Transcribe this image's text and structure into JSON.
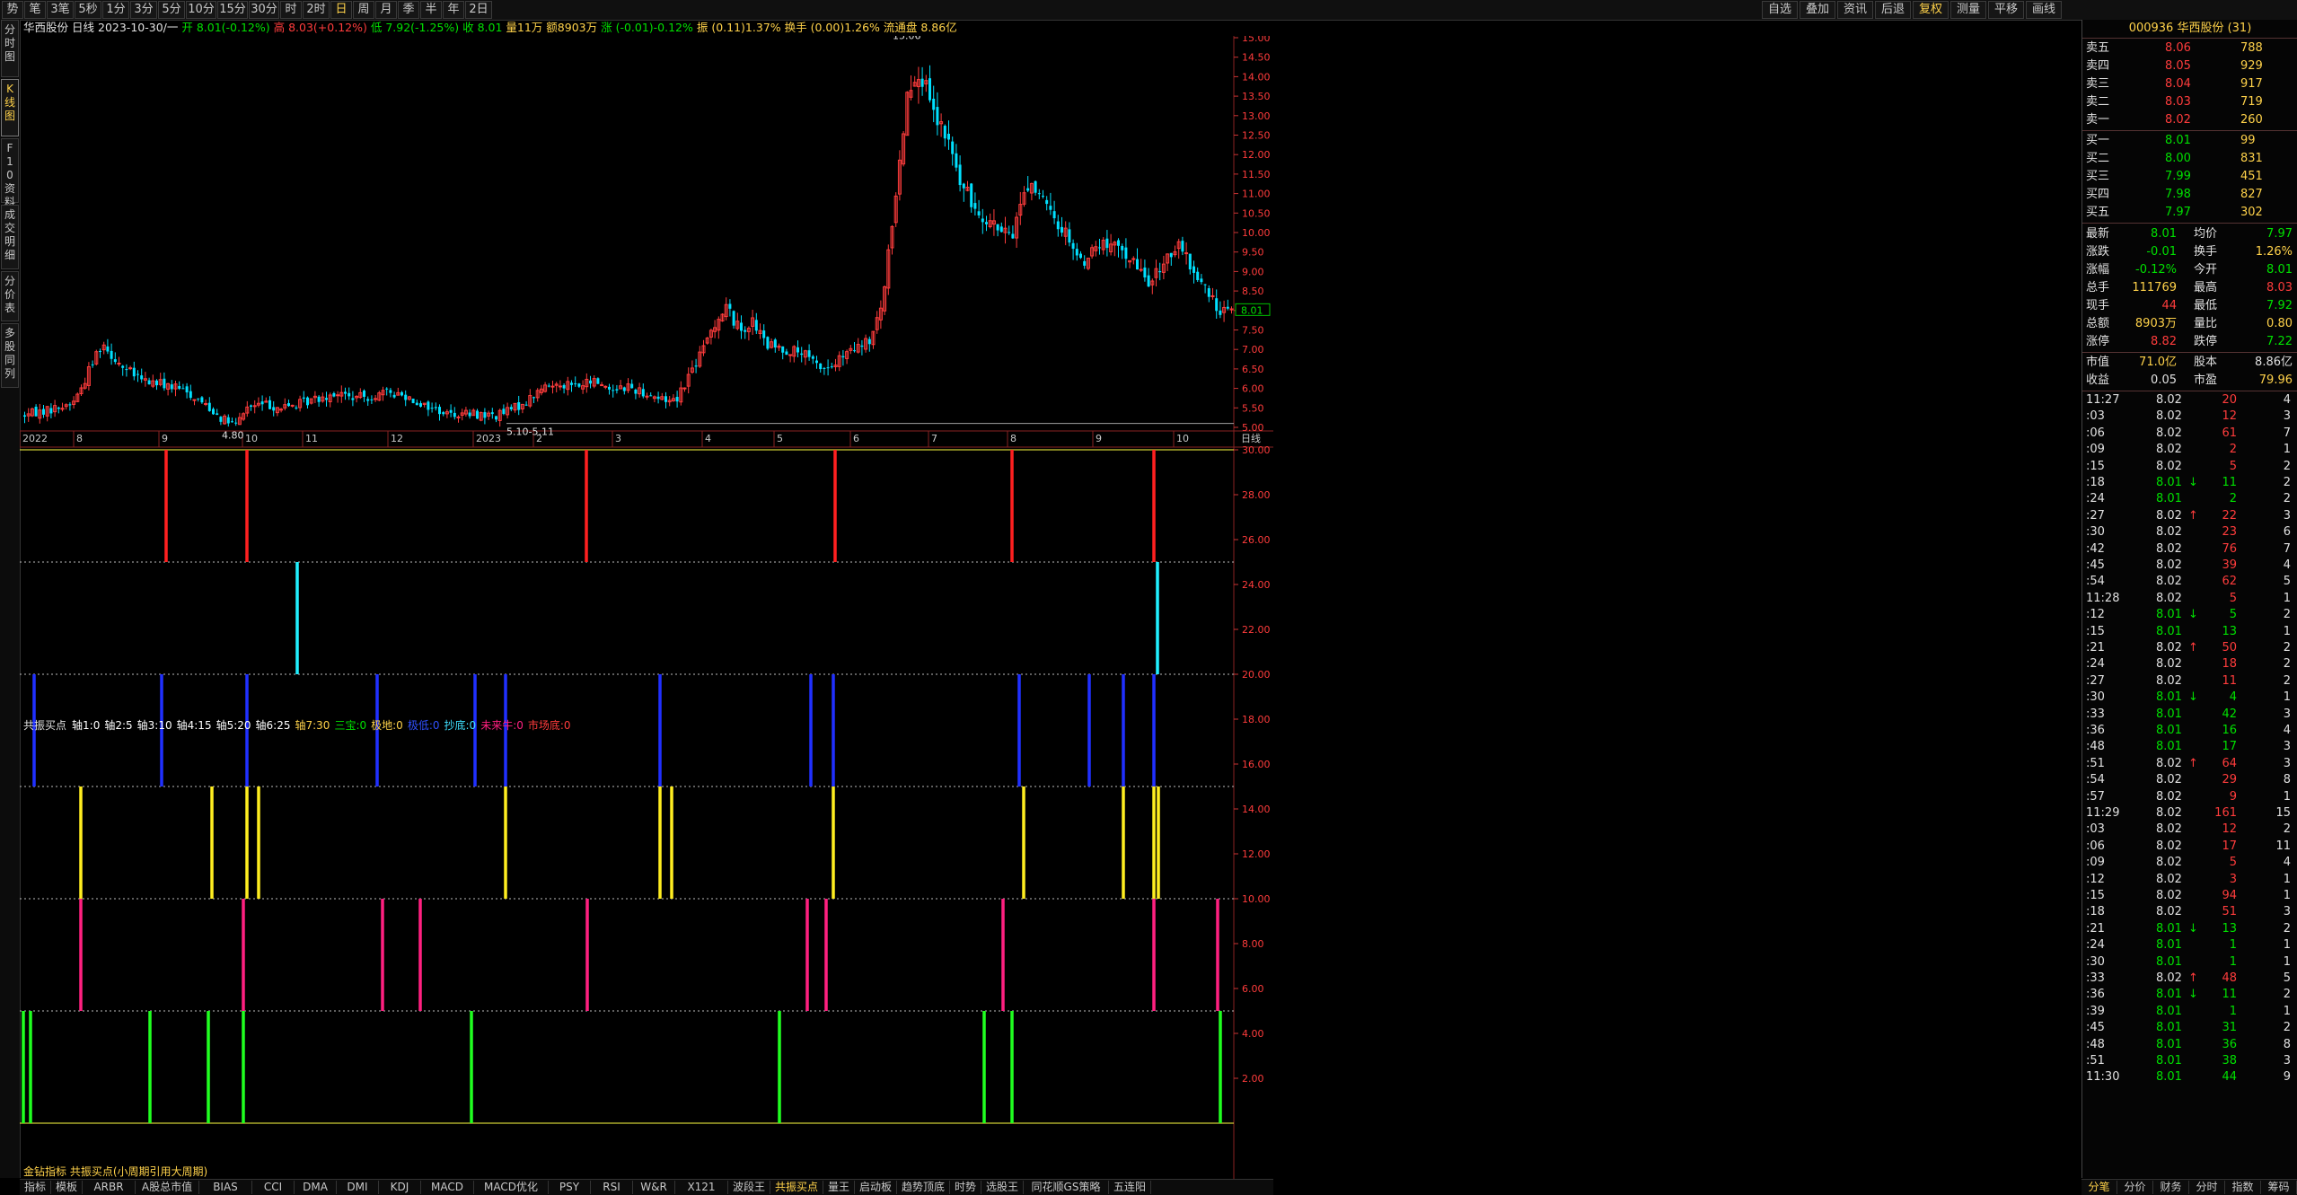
{
  "top_toolbar": {
    "left_buttons": [
      "势",
      "笔",
      "3笔",
      "5秒",
      "1分",
      "3分",
      "5分",
      "10分",
      "15分",
      "30分",
      "时",
      "2时",
      "日",
      "周",
      "月",
      "季",
      "半",
      "年",
      "2日"
    ],
    "active_button": "日",
    "right_buttons": [
      "自选",
      "叠加",
      "资讯",
      "后退",
      "复权",
      "测量",
      "平移",
      "画线"
    ],
    "right_active": "复权"
  },
  "left_nav": [
    {
      "label": "分时图",
      "active": false
    },
    {
      "label": "K线图",
      "active": true
    },
    {
      "label": "F10资料",
      "active": false
    },
    {
      "label": "成交明细",
      "active": false
    },
    {
      "label": "分价表",
      "active": false
    },
    {
      "label": "多股同列",
      "active": false
    }
  ],
  "info_bar": {
    "stock_name": "华西股份",
    "period": "日线",
    "date": "2023-10-30/一",
    "open": "开 8.01(-0.12%)",
    "high": "高 8.03(+0.12%)",
    "low": "低 7.92(-1.25%)",
    "close": "收 8.01",
    "volume": "量11万",
    "amount": "额8903万",
    "change": "涨 (-0.01)-0.12%",
    "amplitude": "振 (0.11)1.37%",
    "turnover": "换手 (0.00)1.26%",
    "float_cap": "流通盘 8.86亿"
  },
  "price_axis": {
    "labels": [
      "15.00",
      "14.50",
      "14.00",
      "13.50",
      "13.00",
      "12.50",
      "12.00",
      "11.50",
      "11.00",
      "10.50",
      "10.00",
      "9.50",
      "9.00",
      "8.50",
      "8.00",
      "7.50",
      "7.00",
      "6.50",
      "6.00",
      "5.50",
      "5.00"
    ],
    "current_price_tag": "8.01"
  },
  "annotations": {
    "peak": "15.06",
    "low1": "4.80",
    "range_low": "5.10-5.11"
  },
  "time_axis": {
    "labels": [
      "2022",
      "8",
      "9",
      "10",
      "11",
      "12",
      "2023",
      "2",
      "3",
      "4",
      "5",
      "6",
      "7",
      "8",
      "9",
      "10"
    ],
    "period_label": "日线"
  },
  "indicator_bar": {
    "name": "共振买点",
    "items": [
      {
        "text": "轴1:0",
        "color": "#ffffff"
      },
      {
        "text": "轴2:5",
        "color": "#ffffff"
      },
      {
        "text": "轴3:10",
        "color": "#ffffff"
      },
      {
        "text": "轴4:15",
        "color": "#ffffff"
      },
      {
        "text": "轴5:20",
        "color": "#ffffff"
      },
      {
        "text": "轴6:25",
        "color": "#ffffff"
      },
      {
        "text": "轴7:30",
        "color": "#ffd24a"
      },
      {
        "text": "三宝:0",
        "color": "#00e000"
      },
      {
        "text": "极地:0",
        "color": "#ffd24a"
      },
      {
        "text": "极低:0",
        "color": "#3050ff"
      },
      {
        "text": "抄底:0",
        "color": "#3fe0ff"
      },
      {
        "text": "未来牛:0",
        "color": "#ff2080"
      },
      {
        "text": "市场底:0",
        "color": "#ff3c3c"
      }
    ]
  },
  "indicator_axis": {
    "labels": [
      "30.00",
      "28.00",
      "26.00",
      "24.00",
      "22.00",
      "20.00",
      "18.00",
      "16.00",
      "14.00",
      "12.00",
      "10.00",
      "8.00",
      "6.00",
      "4.00",
      "2.00"
    ]
  },
  "indicator_footer": "金钻指标 共振买点(小周期引用大周期)",
  "bottom_tabs": [
    "指标",
    "模板",
    "ARBR",
    "A股总市值",
    "BIAS",
    "CCI",
    "DMA",
    "DMI",
    "KDJ",
    "MACD",
    "MACD优化",
    "PSY",
    "RSI",
    "W&R",
    "X121",
    "波段王",
    "共振买点",
    "量王",
    "启动板",
    "趋势顶底",
    "时势",
    "选股王",
    "同花顺GS策略",
    "五连阳"
  ],
  "bottom_active": "共振买点",
  "right_panel": {
    "header": "000936 华西股份 (31)",
    "asks": [
      {
        "label": "卖五",
        "price": "8.06",
        "vol": "788"
      },
      {
        "label": "卖四",
        "price": "8.05",
        "vol": "929"
      },
      {
        "label": "卖三",
        "price": "8.04",
        "vol": "917"
      },
      {
        "label": "卖二",
        "price": "8.03",
        "vol": "719"
      },
      {
        "label": "卖一",
        "price": "8.02",
        "vol": "260"
      }
    ],
    "bids": [
      {
        "label": "买一",
        "price": "8.01",
        "vol": "99"
      },
      {
        "label": "买二",
        "price": "8.00",
        "vol": "831"
      },
      {
        "label": "买三",
        "price": "7.99",
        "vol": "451"
      },
      {
        "label": "买四",
        "price": "7.98",
        "vol": "827"
      },
      {
        "label": "买五",
        "price": "7.97",
        "vol": "302"
      }
    ],
    "stats": [
      {
        "l1": "最新",
        "v1": "8.01",
        "c1": "grn",
        "l2": "均价",
        "v2": "7.97",
        "c2": "grn"
      },
      {
        "l1": "涨跌",
        "v1": "-0.01",
        "c1": "grn",
        "l2": "换手",
        "v2": "1.26%",
        "c2": "yel"
      },
      {
        "l1": "涨幅",
        "v1": "-0.12%",
        "c1": "grn",
        "l2": "今开",
        "v2": "8.01",
        "c2": "grn"
      },
      {
        "l1": "总手",
        "v1": "111769",
        "c1": "yel",
        "l2": "最高",
        "v2": "8.03",
        "c2": "red"
      },
      {
        "l1": "现手",
        "v1": "44",
        "c1": "red",
        "l2": "最低",
        "v2": "7.92",
        "c2": "grn"
      },
      {
        "l1": "总额",
        "v1": "8903万",
        "c1": "yel",
        "l2": "量比",
        "v2": "0.80",
        "c2": "yel"
      },
      {
        "l1": "涨停",
        "v1": "8.82",
        "c1": "red",
        "l2": "跌停",
        "v2": "7.22",
        "c2": "grn"
      }
    ],
    "stats2": [
      {
        "l1": "市值",
        "v1": "71.0亿",
        "c1": "yel",
        "l2": "股本",
        "v2": "8.86亿",
        "c2": "wht"
      },
      {
        "l1": "收益",
        "v1": "0.05",
        "c1": "wht",
        "l2": "市盈",
        "v2": "79.96",
        "c2": "yel"
      }
    ],
    "ticks": [
      {
        "t": "11:27",
        "p": "8.02",
        "pc": "wht",
        "a": "",
        "v": "20",
        "vc": "red",
        "n": "4"
      },
      {
        "t": ":03",
        "p": "8.02",
        "pc": "wht",
        "a": "",
        "v": "12",
        "vc": "red",
        "n": "3"
      },
      {
        "t": ":06",
        "p": "8.02",
        "pc": "wht",
        "a": "",
        "v": "61",
        "vc": "red",
        "n": "7"
      },
      {
        "t": ":09",
        "p": "8.02",
        "pc": "wht",
        "a": "",
        "v": "2",
        "vc": "red",
        "n": "1"
      },
      {
        "t": ":15",
        "p": "8.02",
        "pc": "wht",
        "a": "",
        "v": "5",
        "vc": "red",
        "n": "2"
      },
      {
        "t": ":18",
        "p": "8.01",
        "pc": "grn",
        "a": "↓",
        "v": "11",
        "vc": "grn",
        "n": "2"
      },
      {
        "t": ":24",
        "p": "8.01",
        "pc": "grn",
        "a": "",
        "v": "2",
        "vc": "grn",
        "n": "2"
      },
      {
        "t": ":27",
        "p": "8.02",
        "pc": "wht",
        "a": "↑",
        "v": "22",
        "vc": "red",
        "n": "3"
      },
      {
        "t": ":30",
        "p": "8.02",
        "pc": "wht",
        "a": "",
        "v": "23",
        "vc": "red",
        "n": "6"
      },
      {
        "t": ":42",
        "p": "8.02",
        "pc": "wht",
        "a": "",
        "v": "76",
        "vc": "red",
        "n": "7"
      },
      {
        "t": ":45",
        "p": "8.02",
        "pc": "wht",
        "a": "",
        "v": "39",
        "vc": "red",
        "n": "4"
      },
      {
        "t": ":54",
        "p": "8.02",
        "pc": "wht",
        "a": "",
        "v": "62",
        "vc": "red",
        "n": "5"
      },
      {
        "t": "11:28",
        "p": "8.02",
        "pc": "wht",
        "a": "",
        "v": "5",
        "vc": "red",
        "n": "1"
      },
      {
        "t": ":12",
        "p": "8.01",
        "pc": "grn",
        "a": "↓",
        "v": "5",
        "vc": "grn",
        "n": "2"
      },
      {
        "t": ":15",
        "p": "8.01",
        "pc": "grn",
        "a": "",
        "v": "13",
        "vc": "grn",
        "n": "1"
      },
      {
        "t": ":21",
        "p": "8.02",
        "pc": "wht",
        "a": "↑",
        "v": "50",
        "vc": "red",
        "n": "2"
      },
      {
        "t": ":24",
        "p": "8.02",
        "pc": "wht",
        "a": "",
        "v": "18",
        "vc": "red",
        "n": "2"
      },
      {
        "t": ":27",
        "p": "8.02",
        "pc": "wht",
        "a": "",
        "v": "11",
        "vc": "red",
        "n": "2"
      },
      {
        "t": ":30",
        "p": "8.01",
        "pc": "grn",
        "a": "↓",
        "v": "4",
        "vc": "grn",
        "n": "1"
      },
      {
        "t": ":33",
        "p": "8.01",
        "pc": "grn",
        "a": "",
        "v": "42",
        "vc": "grn",
        "n": "3"
      },
      {
        "t": ":36",
        "p": "8.01",
        "pc": "grn",
        "a": "",
        "v": "16",
        "vc": "grn",
        "n": "4"
      },
      {
        "t": ":48",
        "p": "8.01",
        "pc": "grn",
        "a": "",
        "v": "17",
        "vc": "grn",
        "n": "3"
      },
      {
        "t": ":51",
        "p": "8.02",
        "pc": "wht",
        "a": "↑",
        "v": "64",
        "vc": "red",
        "n": "3"
      },
      {
        "t": ":54",
        "p": "8.02",
        "pc": "wht",
        "a": "",
        "v": "29",
        "vc": "red",
        "n": "8"
      },
      {
        "t": ":57",
        "p": "8.02",
        "pc": "wht",
        "a": "",
        "v": "9",
        "vc": "red",
        "n": "1"
      },
      {
        "t": "11:29",
        "p": "8.02",
        "pc": "wht",
        "a": "",
        "v": "161",
        "vc": "red",
        "n": "15"
      },
      {
        "t": ":03",
        "p": "8.02",
        "pc": "wht",
        "a": "",
        "v": "12",
        "vc": "red",
        "n": "2"
      },
      {
        "t": ":06",
        "p": "8.02",
        "pc": "wht",
        "a": "",
        "v": "17",
        "vc": "red",
        "n": "11"
      },
      {
        "t": ":09",
        "p": "8.02",
        "pc": "wht",
        "a": "",
        "v": "5",
        "vc": "red",
        "n": "4"
      },
      {
        "t": ":12",
        "p": "8.02",
        "pc": "wht",
        "a": "",
        "v": "3",
        "vc": "red",
        "n": "1"
      },
      {
        "t": ":15",
        "p": "8.02",
        "pc": "wht",
        "a": "",
        "v": "94",
        "vc": "red",
        "n": "1"
      },
      {
        "t": ":18",
        "p": "8.02",
        "pc": "wht",
        "a": "",
        "v": "51",
        "vc": "red",
        "n": "3"
      },
      {
        "t": ":21",
        "p": "8.01",
        "pc": "grn",
        "a": "↓",
        "v": "13",
        "vc": "grn",
        "n": "2"
      },
      {
        "t": ":24",
        "p": "8.01",
        "pc": "grn",
        "a": "",
        "v": "1",
        "vc": "grn",
        "n": "1"
      },
      {
        "t": ":30",
        "p": "8.01",
        "pc": "grn",
        "a": "",
        "v": "1",
        "vc": "grn",
        "n": "1"
      },
      {
        "t": ":33",
        "p": "8.02",
        "pc": "wht",
        "a": "↑",
        "v": "48",
        "vc": "red",
        "n": "5"
      },
      {
        "t": ":36",
        "p": "8.01",
        "pc": "grn",
        "a": "↓",
        "v": "11",
        "vc": "grn",
        "n": "2"
      },
      {
        "t": ":39",
        "p": "8.01",
        "pc": "grn",
        "a": "",
        "v": "1",
        "vc": "grn",
        "n": "1"
      },
      {
        "t": ":45",
        "p": "8.01",
        "pc": "grn",
        "a": "",
        "v": "31",
        "vc": "grn",
        "n": "2"
      },
      {
        "t": ":48",
        "p": "8.01",
        "pc": "grn",
        "a": "",
        "v": "36",
        "vc": "grn",
        "n": "8"
      },
      {
        "t": ":51",
        "p": "8.01",
        "pc": "grn",
        "a": "",
        "v": "38",
        "vc": "grn",
        "n": "3"
      },
      {
        "t": "11:30",
        "p": "8.01",
        "pc": "grn",
        "a": "",
        "v": "44",
        "vc": "grn",
        "n": "9"
      }
    ],
    "bottom_tabs": [
      "分笔",
      "分价",
      "财务",
      "分时",
      "指数",
      "筹码"
    ],
    "bottom_active": "分笔"
  },
  "colors": {
    "up": "#ff3c3c",
    "down": "#00e0ff",
    "signal_red": "#ff2020",
    "signal_cyan": "#20f0ff",
    "signal_blue": "#2030ff",
    "signal_yellow": "#ffee20",
    "signal_magenta": "#ff2080",
    "signal_green": "#20ff20"
  }
}
